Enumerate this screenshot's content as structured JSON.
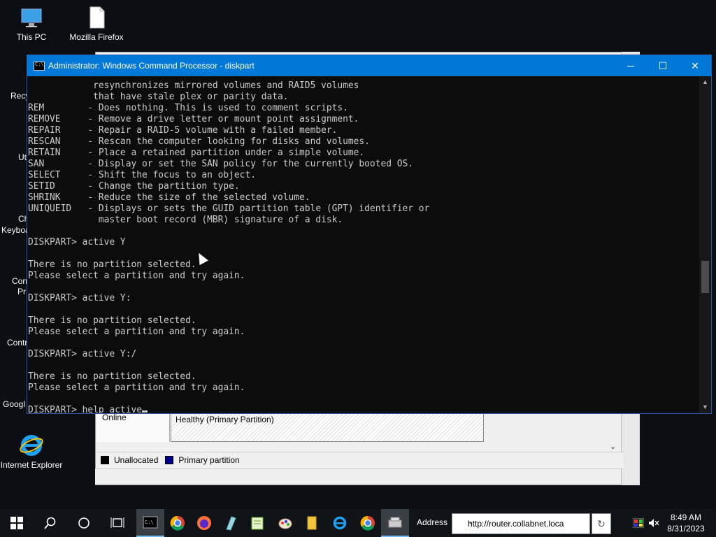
{
  "desktop": {
    "icons": [
      {
        "label": "This PC"
      },
      {
        "label": "Mozilla Firefox"
      },
      {
        "label": "Internet Explorer"
      }
    ],
    "partial_labels": [
      "Recy",
      "Ut",
      "Ch",
      "Keyboa",
      "Con",
      "Pr",
      "Contr",
      "Googl"
    ]
  },
  "background_window": {
    "disk_status": "Online",
    "partition_label": "Healthy (Primary Partition)",
    "legend": [
      {
        "label": "Unallocated",
        "color": "#000000"
      },
      {
        "label": "Primary partition",
        "color": "#00008b"
      }
    ]
  },
  "console": {
    "title": "Administrator: Windows Command Processor - diskpart",
    "buttons": {
      "minimize": "─",
      "maximize": "☐",
      "close": "✕"
    },
    "lines": [
      "            resynchronizes mirrored volumes and RAID5 volumes",
      "            that have stale plex or parity data.",
      "REM        - Does nothing. This is used to comment scripts.",
      "REMOVE     - Remove a drive letter or mount point assignment.",
      "REPAIR     - Repair a RAID-5 volume with a failed member.",
      "RESCAN     - Rescan the computer looking for disks and volumes.",
      "RETAIN     - Place a retained partition under a simple volume.",
      "SAN        - Display or set the SAN policy for the currently booted OS.",
      "SELECT     - Shift the focus to an object.",
      "SETID      - Change the partition type.",
      "SHRINK     - Reduce the size of the selected volume.",
      "UNIQUEID   - Displays or sets the GUID partition table (GPT) identifier or",
      "             master boot record (MBR) signature of a disk.",
      "",
      "DISKPART> active Y",
      "",
      "There is no partition selected.",
      "Please select a partition and try again.",
      "",
      "DISKPART> active Y:",
      "",
      "There is no partition selected.",
      "Please select a partition and try again.",
      "",
      "DISKPART> active Y:/",
      "",
      "There is no partition selected.",
      "Please select a partition and try again.",
      "",
      "DISKPART> help active"
    ]
  },
  "taskbar": {
    "items": [
      "start-icon",
      "search-icon",
      "cortana-icon",
      "task-view-icon",
      "cmd-icon",
      "chrome-icon",
      "firefox-icon",
      "app-icon",
      "notepad-icon",
      "paint-icon",
      "file-explorer-icon",
      "ie-icon",
      "chrome-icon",
      "server-manager-icon"
    ],
    "address_label": "Address",
    "address_value": "http://router.collabnet.loca",
    "time": "8:49 AM",
    "date": "8/31/2023"
  }
}
